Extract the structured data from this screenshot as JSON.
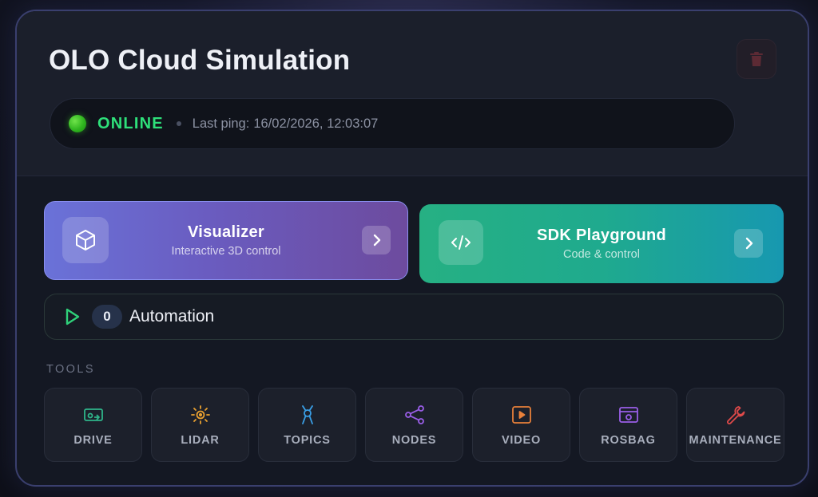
{
  "header": {
    "title": "OLO Cloud Simulation",
    "delete_icon": "trash-icon"
  },
  "status": {
    "state": "ONLINE",
    "ping_label": "Last ping:",
    "ping_value": "16/02/2026, 12:03:07",
    "color": "#2ee07a"
  },
  "actions": {
    "visualizer": {
      "title": "Visualizer",
      "subtitle": "Interactive 3D control",
      "icon": "cube-icon"
    },
    "sdk": {
      "title": "SDK Playground",
      "subtitle": "Code & control",
      "icon": "code-icon"
    }
  },
  "automation": {
    "count": "0",
    "label": "Automation",
    "icon": "play-icon"
  },
  "tools": {
    "section_label": "TOOLS",
    "items": [
      {
        "label": "DRIVE",
        "icon": "drive-icon",
        "color": "#2fb58a"
      },
      {
        "label": "LIDAR",
        "icon": "lidar-icon",
        "color": "#e8a030"
      },
      {
        "label": "TOPICS",
        "icon": "topics-icon",
        "color": "#3aa0e8"
      },
      {
        "label": "NODES",
        "icon": "nodes-icon",
        "color": "#9a5ee8"
      },
      {
        "label": "VIDEO",
        "icon": "video-icon",
        "color": "#e8803a"
      },
      {
        "label": "ROSBAG",
        "icon": "rosbag-icon",
        "color": "#9a5ee8"
      },
      {
        "label": "MAINTENANCE",
        "icon": "wrench-icon",
        "color": "#e04a4a"
      }
    ]
  }
}
